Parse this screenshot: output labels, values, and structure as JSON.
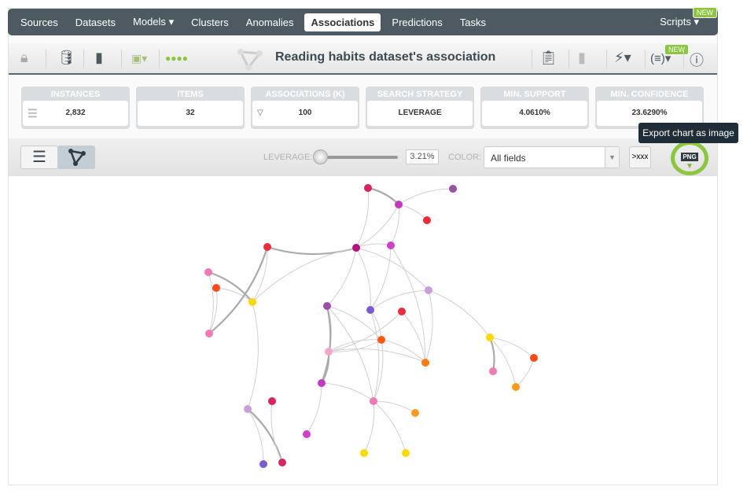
{
  "nav": {
    "items": [
      "Sources",
      "Datasets",
      "Models",
      "Clusters",
      "Anomalies",
      "Associations",
      "Predictions",
      "Tasks"
    ],
    "active": "Associations",
    "scripts": "Scripts",
    "new_badge": "NEW"
  },
  "toolbar": {
    "title": "Reading habits dataset's association",
    "new_badge": "NEW"
  },
  "cards": [
    {
      "label": "INSTANCES",
      "value": "2,832"
    },
    {
      "label": "ITEMS",
      "value": "32"
    },
    {
      "label": "ASSOCIATIONS (K)",
      "value": "100"
    },
    {
      "label": "SEARCH STRATEGY",
      "value": "LEVERAGE"
    },
    {
      "label": "MIN. SUPPORT",
      "value": "4.0610%"
    },
    {
      "label": "MIN. CONFIDENCE",
      "value": "23.6290%"
    }
  ],
  "controls": {
    "leverage_label": "LEVERAGE:",
    "leverage_value": "3.21%",
    "color_label": "COLOR:",
    "color_selected": "All fields",
    "export_label": "PNG",
    "tooltip": "Export chart as image"
  },
  "accent": "#8cc63f"
}
